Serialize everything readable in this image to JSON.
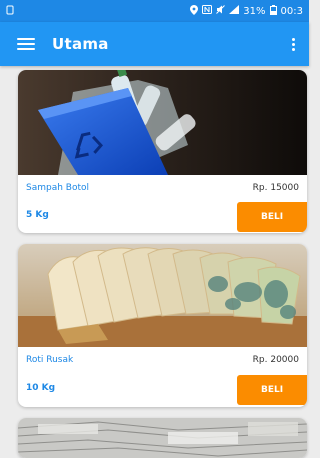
{
  "status_bar": {
    "battery": "31%",
    "time": "00:3"
  },
  "toolbar": {
    "title": "Utama"
  },
  "products": [
    {
      "name": "Sampah Botol",
      "price": "Rp. 15000",
      "weight": "5 Kg",
      "buy_label": "BELI",
      "image": "recycle-bin-bottles"
    },
    {
      "name": "Roti Rusak",
      "price": "Rp. 20000",
      "weight": "10 Kg",
      "buy_label": "BELI",
      "image": "moldy-bread"
    },
    {
      "image": "newspaper-stack"
    }
  ],
  "colors": {
    "toolbar": "#2196f3",
    "statusbar": "#1e88e5",
    "buy_button": "#fb8c00",
    "accent_text": "#1e88e5"
  }
}
